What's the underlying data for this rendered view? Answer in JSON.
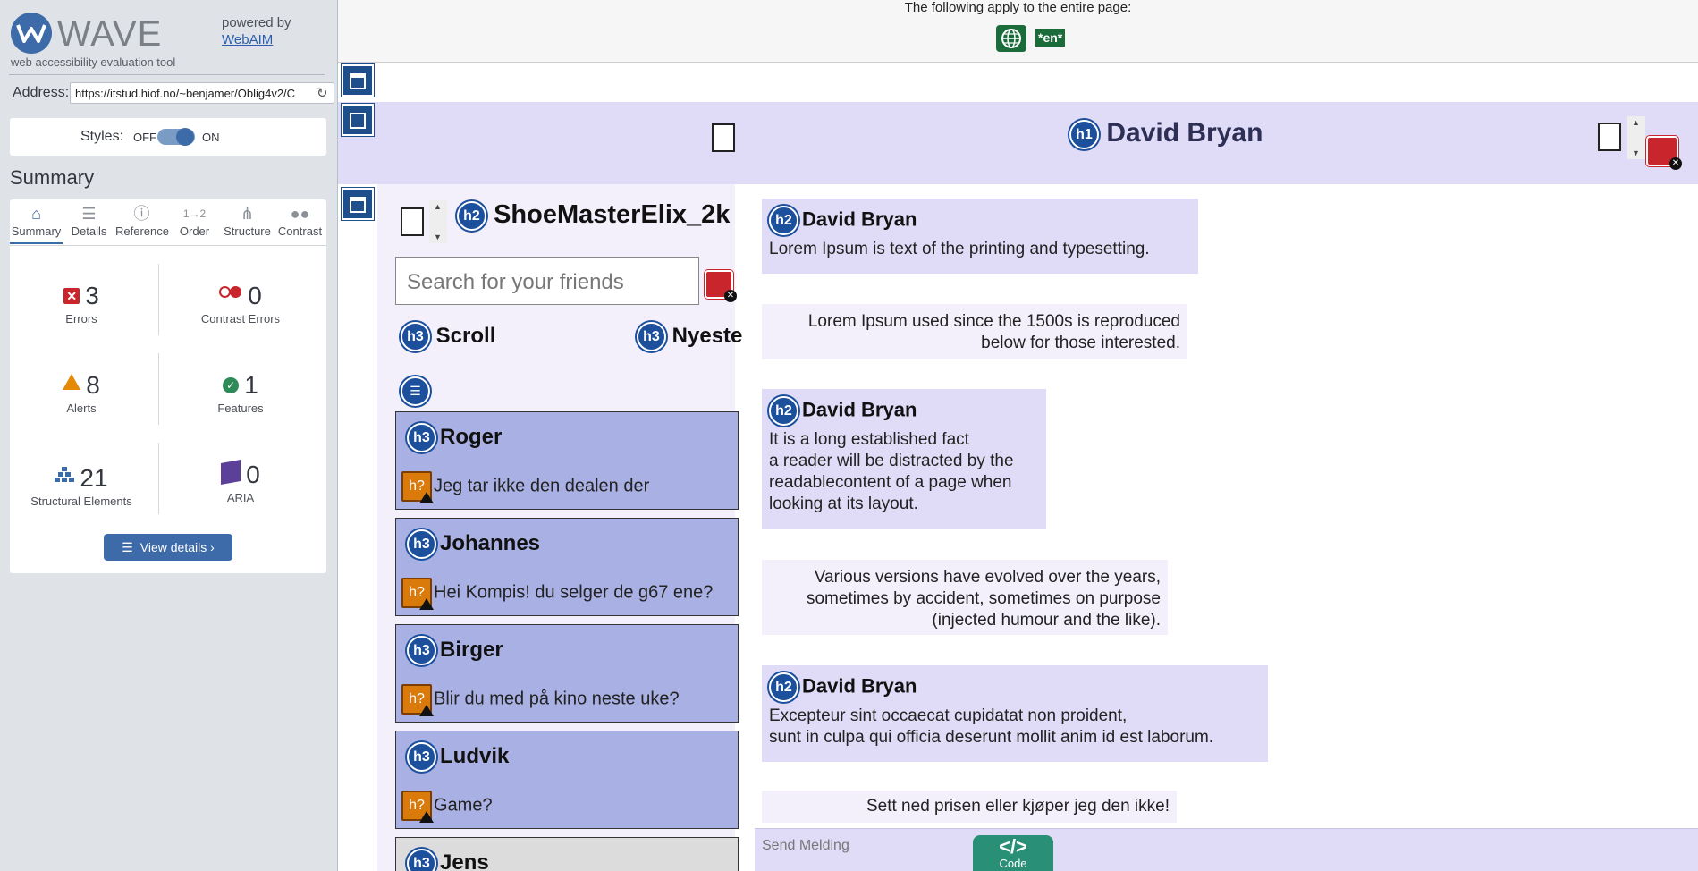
{
  "wave": {
    "logo_text": "WAVE",
    "logo_subtitle": "web accessibility evaluation tool",
    "powered_by": "powered by",
    "powered_by_link": "WebAIM",
    "address_label": "Address:",
    "address_value": "https://itstud.hiof.no/~benjamer/Oblig4v2/C",
    "styles_label": "Styles:",
    "styles_off": "OFF",
    "styles_on": "ON",
    "styles_enabled": true,
    "summary_title": "Summary",
    "tabs": [
      {
        "label": "Summary",
        "icon": "home-icon",
        "active": true
      },
      {
        "label": "Details",
        "icon": "list-icon",
        "active": false
      },
      {
        "label": "Reference",
        "icon": "info-icon",
        "active": false
      },
      {
        "label": "Order",
        "icon": "order-icon",
        "active": false
      },
      {
        "label": "Structure",
        "icon": "structure-icon",
        "active": false
      },
      {
        "label": "Contrast",
        "icon": "contrast-icon",
        "active": false
      }
    ],
    "stats": {
      "errors": {
        "value": "3",
        "label": "Errors"
      },
      "contrast_errors": {
        "value": "0",
        "label": "Contrast Errors"
      },
      "alerts": {
        "value": "8",
        "label": "Alerts"
      },
      "features": {
        "value": "1",
        "label": "Features"
      },
      "structural": {
        "value": "21",
        "label": "Structural Elements"
      },
      "aria": {
        "value": "0",
        "label": "ARIA"
      }
    },
    "view_details": "View details ›"
  },
  "page": {
    "banner_text": "The following apply to the entire page:",
    "lang_badge": "*en*",
    "h1_badge": "h1",
    "title": "David Bryan",
    "h2_badge": "h2",
    "h3_badge": "h3",
    "q_badge": "h?",
    "username": "ShoeMasterElix_2k",
    "search_placeholder": "Search for your friends",
    "scroll_heading": "Scroll",
    "nyeste_heading": "Nyeste",
    "friends": [
      {
        "name": "Roger",
        "message": "Jeg tar ikke den dealen der"
      },
      {
        "name": "Johannes",
        "message": "Hei Kompis! du selger de g67 ene?"
      },
      {
        "name": "Birger",
        "message": "Blir du med på kino neste uke?"
      },
      {
        "name": "Ludvik",
        "message": "Game?"
      },
      {
        "name": "Jens",
        "message": ""
      }
    ],
    "messages": [
      {
        "heading": "David Bryan",
        "lines": [
          "Lorem Ipsum is text of the printing and typesetting."
        ]
      },
      {
        "heading": "",
        "lines": [
          "Lorem Ipsum used since the 1500s is reproduced",
          "below for those interested."
        ]
      },
      {
        "heading": "David Bryan",
        "lines": [
          "It is a long established fact",
          "a reader will be distracted by the",
          "readablecontent of a page when",
          "looking at its layout."
        ]
      },
      {
        "heading": "",
        "lines": [
          "Various versions have evolved over the years,",
          "sometimes by accident, sometimes on purpose",
          "(injected humour and the like)."
        ]
      },
      {
        "heading": "David Bryan",
        "lines": [
          "Excepteur sint occaecat cupidatat non proident,",
          "sunt in culpa qui officia deserunt mollit anim id est laborum."
        ]
      },
      {
        "heading": "",
        "lines": [
          "Sett ned prisen eller kjøper jeg den ikke!"
        ]
      }
    ],
    "send_placeholder": "Send Melding",
    "code_label": "Code",
    "code_icon": "</>"
  }
}
